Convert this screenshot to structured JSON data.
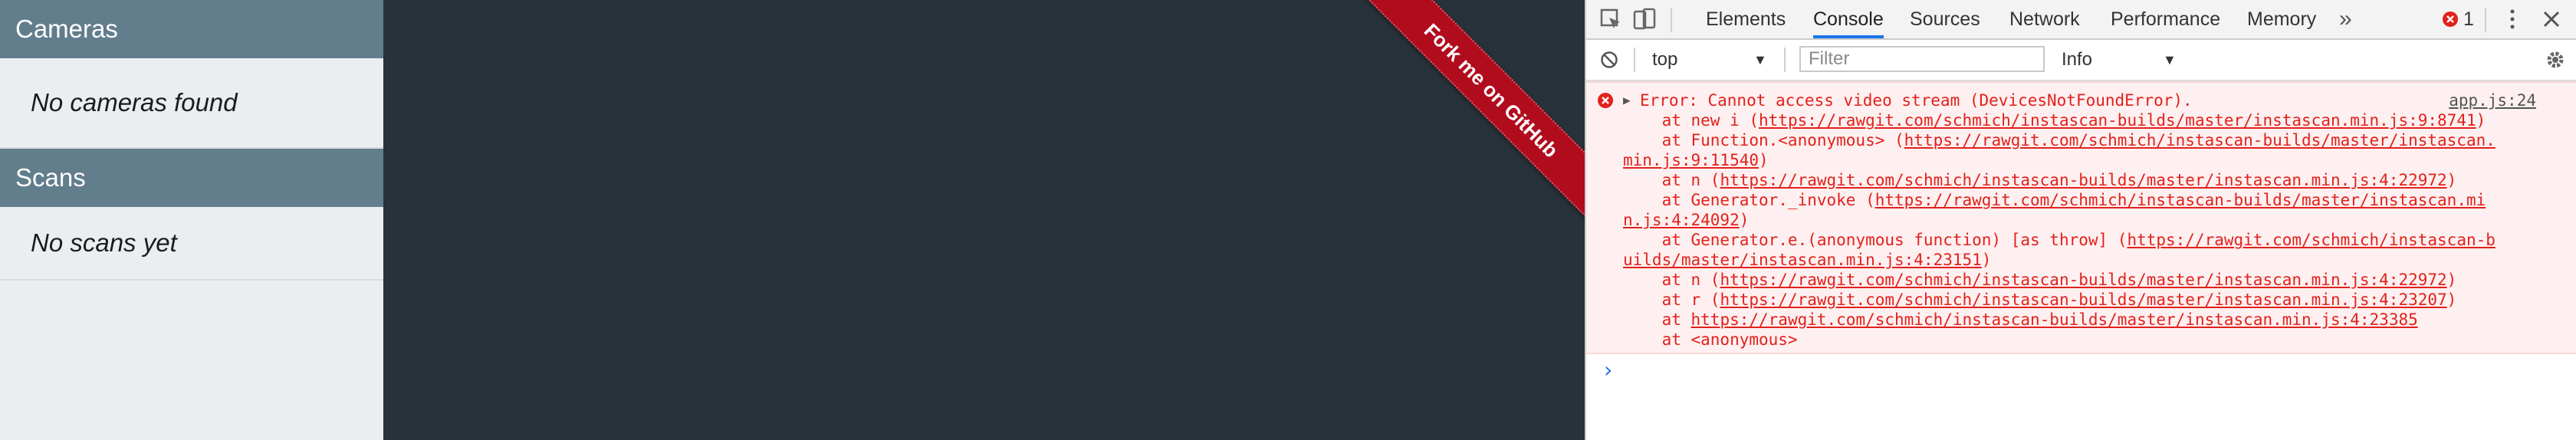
{
  "sidebar": {
    "cameras_title": "Cameras",
    "cameras_empty": "No cameras found",
    "scans_title": "Scans",
    "scans_empty": "No scans yet"
  },
  "ribbon": {
    "label": "Fork me on GitHub",
    "color": "#b00c1e"
  },
  "devtools": {
    "tabs": [
      "Elements",
      "Console",
      "Sources",
      "Network",
      "Performance",
      "Memory"
    ],
    "active_tab": "Console",
    "more_tabs_icon": "chevron-double-right-icon",
    "error_count": "1",
    "context": "top",
    "filter_placeholder": "Filter",
    "level": "Info"
  },
  "console": {
    "error_message": "Error: Cannot access video stream (DevicesNotFoundError).",
    "source": "app.js:24",
    "stack": [
      {
        "prefix": "    at new i (",
        "url": "https://rawgit.com/schmich/instascan-builds/master/instascan.min.js:9:8741",
        "suffix": ")"
      },
      {
        "prefix": "    at Function.<anonymous> (",
        "url": "https://rawgit.com/schmich/instascan-builds/master/instascan.",
        "suffix": ""
      },
      {
        "prefix": "",
        "url": "min.js:9:11540",
        "suffix": ")"
      },
      {
        "prefix": "    at n (",
        "url": "https://rawgit.com/schmich/instascan-builds/master/instascan.min.js:4:22972",
        "suffix": ")"
      },
      {
        "prefix": "    at Generator._invoke (",
        "url": "https://rawgit.com/schmich/instascan-builds/master/instascan.mi",
        "suffix": ""
      },
      {
        "prefix": "",
        "url": "n.js:4:24092",
        "suffix": ")"
      },
      {
        "prefix": "    at Generator.e.(anonymous function) [as throw] (",
        "url": "https://rawgit.com/schmich/instascan-b",
        "suffix": ""
      },
      {
        "prefix": "",
        "url": "uilds/master/instascan.min.js:4:23151",
        "suffix": ")"
      },
      {
        "prefix": "    at n (",
        "url": "https://rawgit.com/schmich/instascan-builds/master/instascan.min.js:4:22972",
        "suffix": ")"
      },
      {
        "prefix": "    at r (",
        "url": "https://rawgit.com/schmich/instascan-builds/master/instascan.min.js:4:23207",
        "suffix": ")"
      },
      {
        "prefix": "    at ",
        "url": "https://rawgit.com/schmich/instascan-builds/master/instascan.min.js:4:23385",
        "suffix": ""
      },
      {
        "prefix": "    at <anonymous>",
        "url": "",
        "suffix": ""
      }
    ]
  }
}
